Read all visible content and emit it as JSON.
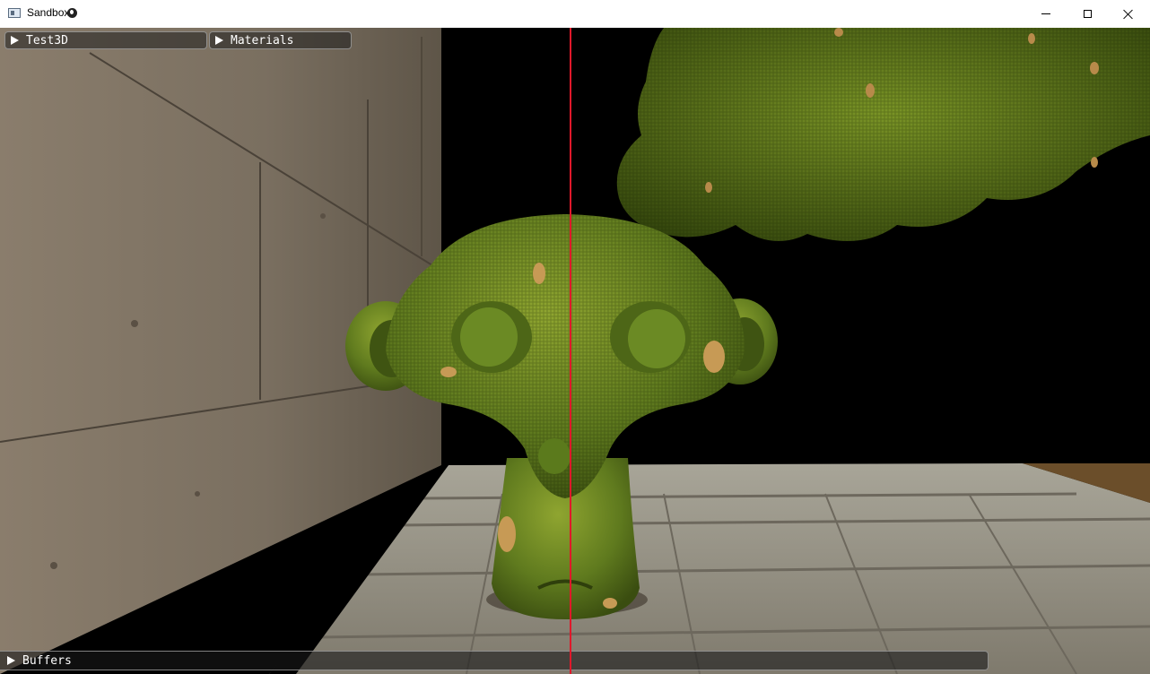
{
  "window": {
    "title": "Sandbox",
    "icon": "app-window-icon",
    "badge_icon": "globe-icon",
    "controls": [
      "minimize-icon",
      "maximize-icon",
      "close-icon"
    ]
  },
  "panels": {
    "test3d": {
      "label": "Test3D",
      "icon": "expand-triangle-icon"
    },
    "materials": {
      "label": "Materials",
      "icon": "expand-triangle-icon"
    },
    "buffers": {
      "label": "Buffers",
      "icon": "expand-triangle-icon"
    }
  },
  "colors": {
    "split_line": "#e0182a",
    "panel_text": "#ffffff",
    "sky": "#000000"
  },
  "scene": {
    "objects": [
      "stone-wall",
      "cobblestone-floor",
      "monkey-head-model",
      "foliage-mass"
    ],
    "material": "green-fabric"
  }
}
